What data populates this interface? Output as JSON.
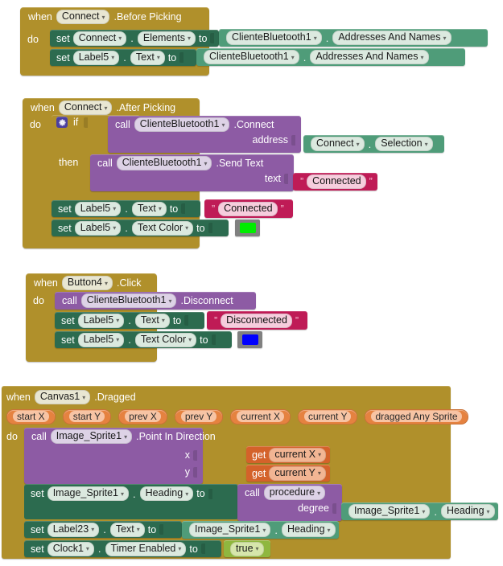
{
  "palette": {
    "event_gold": "#b0902b",
    "setter_green": "#2c6b4f",
    "getter_green": "#4f9c79",
    "call_purple": "#8d5ba4",
    "text_crimson": "#bf1b56",
    "getvar_orange": "#d4622a",
    "logic_green": "#8fb73f",
    "param_orange": "#e58240",
    "color_connected": "#00ee00",
    "color_disconnected": "#0000ff",
    "swatch_frame": "#808080"
  },
  "blocks": {
    "before_picking": {
      "when_kw": "when",
      "component": "Connect",
      "event": ".Before Picking",
      "do_kw": "do",
      "rows": [
        {
          "set_kw": "set",
          "target": "Connect",
          "dot": ".",
          "property": "Elements",
          "to_kw": "to",
          "value_component": "ClienteBluetooth1",
          "value_property": "Addresses And Names"
        },
        {
          "set_kw": "set",
          "target": "Label5",
          "dot": ".",
          "property": "Text",
          "to_kw": "to",
          "value_component": "ClienteBluetooth1",
          "value_property": "Addresses And Names"
        }
      ]
    },
    "after_picking": {
      "when_kw": "when",
      "component": "Connect",
      "event": ".After Picking",
      "do_kw": "do",
      "if_kw": "if",
      "then_kw": "then",
      "if_call": {
        "call_kw": "call",
        "component": "ClienteBluetooth1",
        "method": ".Connect",
        "arg_label": "address",
        "arg_component": "Connect",
        "arg_property": "Selection"
      },
      "then_call": {
        "call_kw": "call",
        "component": "ClienteBluetooth1",
        "method": ".Send Text",
        "arg_label": "text",
        "arg_text": "Connected",
        "quote": "”"
      },
      "rows": [
        {
          "set_kw": "set",
          "target": "Label5",
          "dot": ".",
          "property": "Text",
          "to_kw": "to",
          "value_text": "Connected",
          "quote": "”"
        },
        {
          "set_kw": "set",
          "target": "Label5",
          "dot": ".",
          "property": "Text Color",
          "to_kw": "to",
          "value_color": "#00ee00"
        }
      ]
    },
    "button4_click": {
      "when_kw": "when",
      "component": "Button4",
      "event": ".Click",
      "do_kw": "do",
      "call": {
        "call_kw": "call",
        "component": "ClienteBluetooth1",
        "method": ".Disconnect"
      },
      "rows": [
        {
          "set_kw": "set",
          "target": "Label5",
          "dot": ".",
          "property": "Text",
          "to_kw": "to",
          "value_text": "Disconnected",
          "quote": "”"
        },
        {
          "set_kw": "set",
          "target": "Label5",
          "dot": ".",
          "property": "Text Color",
          "to_kw": "to",
          "value_color": "#0000ff"
        }
      ]
    },
    "canvas_dragged": {
      "when_kw": "when",
      "component": "Canvas1",
      "event": ".Dragged",
      "do_kw": "do",
      "params": [
        "start X",
        "start Y",
        "prev X",
        "prev Y",
        "current X",
        "current Y",
        "dragged Any Sprite"
      ],
      "point_call": {
        "call_kw": "call",
        "component": "Image_Sprite1",
        "method": ".Point In Direction",
        "x_label": "x",
        "x_get_kw": "get",
        "x_var": "current X",
        "y_label": "y",
        "y_get_kw": "get",
        "y_var": "current Y"
      },
      "set_heading": {
        "set_kw": "set",
        "target": "Image_Sprite1",
        "dot": ".",
        "property": "Heading",
        "to_kw": "to",
        "call_kw": "call",
        "procedure": "procedure",
        "arg_label": "degree",
        "arg_component": "Image_Sprite1",
        "arg_property": "Heading"
      },
      "set_label23": {
        "set_kw": "set",
        "target": "Label23",
        "dot": ".",
        "property": "Text",
        "to_kw": "to",
        "value_component": "Image_Sprite1",
        "value_property": "Heading"
      },
      "set_clock": {
        "set_kw": "set",
        "target": "Clock1",
        "dot": ".",
        "property": "Timer Enabled",
        "to_kw": "to",
        "value_logic": "true"
      }
    }
  }
}
